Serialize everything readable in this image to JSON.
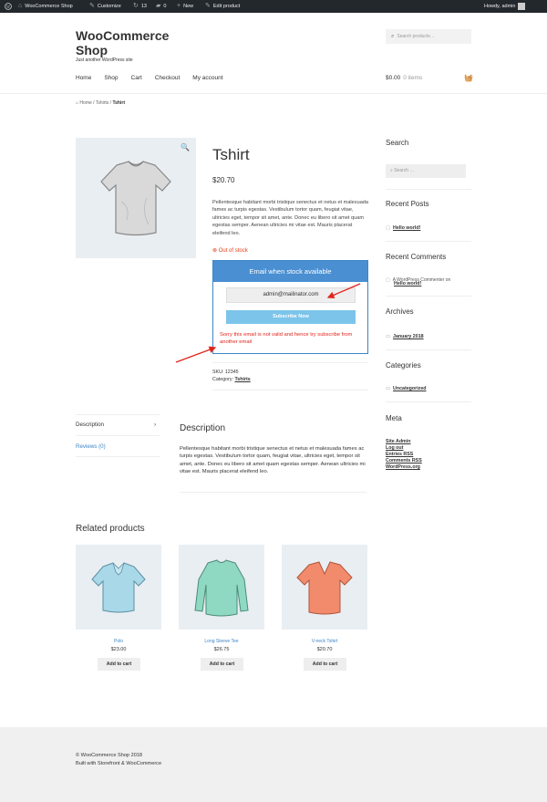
{
  "adminbar": {
    "site": "WooCommerce Shop",
    "customize": "Customize",
    "updates": "13",
    "comments": "0",
    "new": "New",
    "edit": "Edit product",
    "howdy": "Howdy, admin"
  },
  "header": {
    "site_title": "WooCommerce Shop",
    "tagline": "Just another WordPress site",
    "search_placeholder": "Search products…",
    "nav": [
      "Home",
      "Shop",
      "Cart",
      "Checkout",
      "My account"
    ],
    "cart_total": "$0.00",
    "cart_items": "0 items"
  },
  "breadcrumb": {
    "home": "Home",
    "cat": "Tshirts",
    "current": "Tshirt"
  },
  "product": {
    "title": "Tshirt",
    "price": "$20.70",
    "description": "Pellentesque habitant morbi tristique senectus et netus et malesuada fames ac turpis egestas. Vestibulum tortor quam, feugiat vitae, ultricies eget, tempor sit amet, ante. Donec eu libero sit amet quam egestas semper. Aenean ultricies mi vitae est. Mauris placerat eleifend leo.",
    "stock": "Out of stock",
    "notify_heading": "Email when stock available",
    "email_value": "admin@mailinator.com",
    "subscribe_label": "Subscribe Now",
    "error": "Sorry this email is not valid and hence try subscribe from another email",
    "sku_label": "SKU:",
    "sku": "12345",
    "category_label": "Category:",
    "category": "Tshirts"
  },
  "tabs": {
    "description": "Description",
    "reviews": "Reviews (0)",
    "panel_title": "Description",
    "panel_text": "Pellentesque habitant morbi tristique senectus et netus et malesuada fames ac turpis egestas. Vestibulum tortor quam, feugiat vitae, ultricies eget, tempor sit amet, ante. Donec eu libero sit amet quam egestas semper. Aenean ultricies mi vitae est. Mauris placerat eleifend leo."
  },
  "related": {
    "title": "Related products",
    "items": [
      {
        "name": "Polo",
        "price": "$23.00",
        "button": "Add to cart",
        "color": "#a9d8e8"
      },
      {
        "name": "Long Sleeve Tee",
        "price": "$26.75",
        "button": "Add to cart",
        "color": "#8fd8c2"
      },
      {
        "name": "V-neck Tshirt",
        "price": "$20.70",
        "button": "Add to cart",
        "color": "#f28b6c"
      }
    ]
  },
  "sidebar": {
    "search_title": "Search",
    "search_placeholder": "Search …",
    "recent_posts_title": "Recent Posts",
    "recent_post": "Hello world!",
    "recent_comments_title": "Recent Comments",
    "comment_author": "A WordPress Commenter on",
    "comment_post": "Hello world!",
    "archives_title": "Archives",
    "archive": "January 2018",
    "categories_title": "Categories",
    "category": "Uncategorized",
    "meta_title": "Meta",
    "meta_links": [
      "Site Admin",
      "Log out",
      "Entries RSS",
      "Comments RSS",
      "WordPress.org"
    ]
  },
  "footer": {
    "copyright": "© WooCommerce Shop 2018",
    "built": "Built with Storefront & WooCommerce"
  },
  "colors": {
    "accent": "#3d86c6",
    "error": "#e2231a",
    "stock_header": "#4a8fd2",
    "button": "#7cc4ea"
  }
}
